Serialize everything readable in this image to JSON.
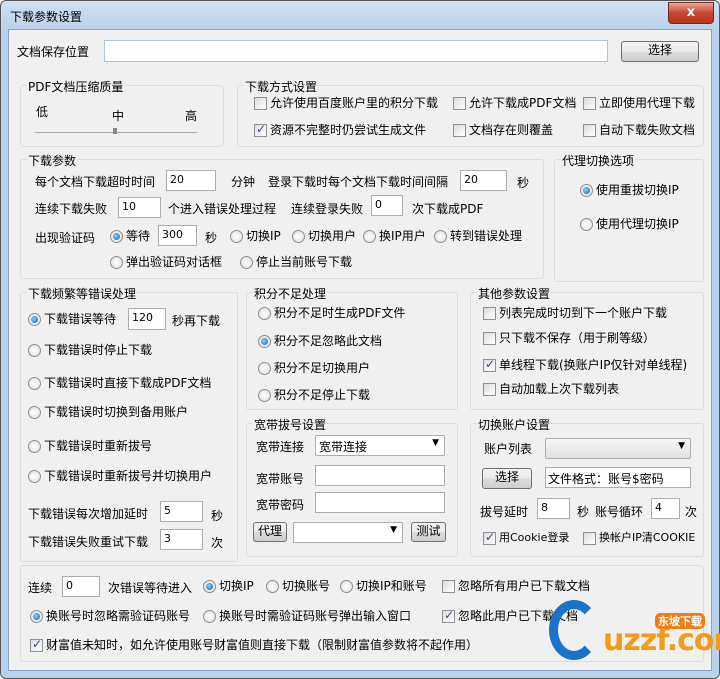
{
  "window": {
    "title": "下载参数设置",
    "close": "x"
  },
  "save": {
    "label": "文档保存位置",
    "value": "",
    "choose": "选择"
  },
  "pdf": {
    "title": "PDF文档压缩质量",
    "low": "低",
    "mid": "中",
    "high": "高",
    "quality": 0.5
  },
  "mode": {
    "title": "下载方式设置",
    "items": [
      {
        "label": "允许使用百度账户里的积分下载",
        "checked": false
      },
      {
        "label": "允许下载成PDF文档",
        "checked": false
      },
      {
        "label": "立即使用代理下载",
        "checked": false
      },
      {
        "label": "资源不完整时仍尝试生成文件",
        "checked": true
      },
      {
        "label": "文档存在则覆盖",
        "checked": false
      },
      {
        "label": "自动下载失败文档",
        "checked": false
      }
    ]
  },
  "params": {
    "title": "下载参数",
    "timeout_label": "每个文档下载超时时间",
    "timeout": "20",
    "minutes": "分钟",
    "interval_label": "登录下载时每个文档下载时间间隔",
    "interval": "20",
    "sec": "秒",
    "fail_label": "连续下载失败",
    "fail": "10",
    "fail_suffix": "个进入错误处理过程",
    "login_fail_label": "连续登录失败",
    "login_fail": "0",
    "login_fail_suffix": "次下载成PDF",
    "captcha_label": "出现验证码",
    "wait": "等待",
    "wait_value": "300",
    "wait_sec": "秒",
    "switch_ip": "切换IP",
    "switch_user": "切换用户",
    "switch_ip_user": "换IP用户",
    "to_error": "转到错误处理",
    "popup": "弹出验证码对话框",
    "stop_account": "停止当前账号下载"
  },
  "proxy": {
    "title": "代理切换选项",
    "redial": "使用重拔切换IP",
    "use_proxy": "使用代理切换IP"
  },
  "errors": {
    "title": "下载频繁等错误处理",
    "wait": "下载错误等待",
    "wait_value": "120",
    "wait_suffix": "秒再下载",
    "stop": "下载错误时停止下载",
    "pdf": "下载错误时直接下载成PDF文档",
    "backup": "下载错误时切换到备用账户",
    "redial": "下载错误时重新拔号",
    "redial_switch": "下载错误时重新拔号并切换用户",
    "delay_label": "下载错误每次增加延时",
    "delay": "5",
    "delay_unit": "秒",
    "retry_label": "下载错误失败重试下载",
    "retry": "3",
    "retry_unit": "次"
  },
  "points": {
    "title": "积分不足处理",
    "items": [
      "积分不足时生成PDF文件",
      "积分不足忽略此文档",
      "积分不足切换用户",
      "积分不足停止下载"
    ],
    "selected": 1
  },
  "other": {
    "title": "其他参数设置",
    "items": [
      {
        "label": "列表完成时切到下一个账户下载",
        "checked": false
      },
      {
        "label": "只下载不保存（用于刷等级）",
        "checked": false
      },
      {
        "label": "单线程下载(换账户IP仅针对单线程)",
        "checked": true
      },
      {
        "label": "自动加载上次下载列表",
        "checked": false
      }
    ]
  },
  "broadband": {
    "title": "宽带拔号设置",
    "conn_label": "宽带连接",
    "conn_value": "宽带连接",
    "account_label": "宽带账号",
    "password_label": "宽带密码",
    "proxy_btn": "代理",
    "test_btn": "测试"
  },
  "account": {
    "title": "切换账户设置",
    "list_label": "账户列表",
    "choose": "选择",
    "format": "文件格式：账号$密码",
    "dial_delay_label": "拔号延时",
    "dial_delay": "8",
    "sec": "秒",
    "cycle_label": "账号循环",
    "cycle": "4",
    "times": "次",
    "cookie": "用Cookie登录",
    "clear_cookie": "换帐户IP清COOKIE"
  },
  "bottom": {
    "cont": "连续",
    "cont_value": "0",
    "cont_suffix": "次错误等待进入",
    "switch_ip": "切换IP",
    "switch_account": "切换账号",
    "switch_both": "切换IP和账号",
    "ignore_all": "忽略所有用户已下载文档",
    "ignore_captcha": "换账号时忽略需验证码账号",
    "popup_captcha": "换账号时需验证码账号弹出输入窗口",
    "ignore_user": "忽略此用户已下载文档",
    "wealth": "财富值未知时，如允许使用账号财富值则直接下载（限制财富值参数将不起作用）"
  },
  "watermark": {
    "brand": "uzzf.com",
    "cn": "东坡下载"
  }
}
